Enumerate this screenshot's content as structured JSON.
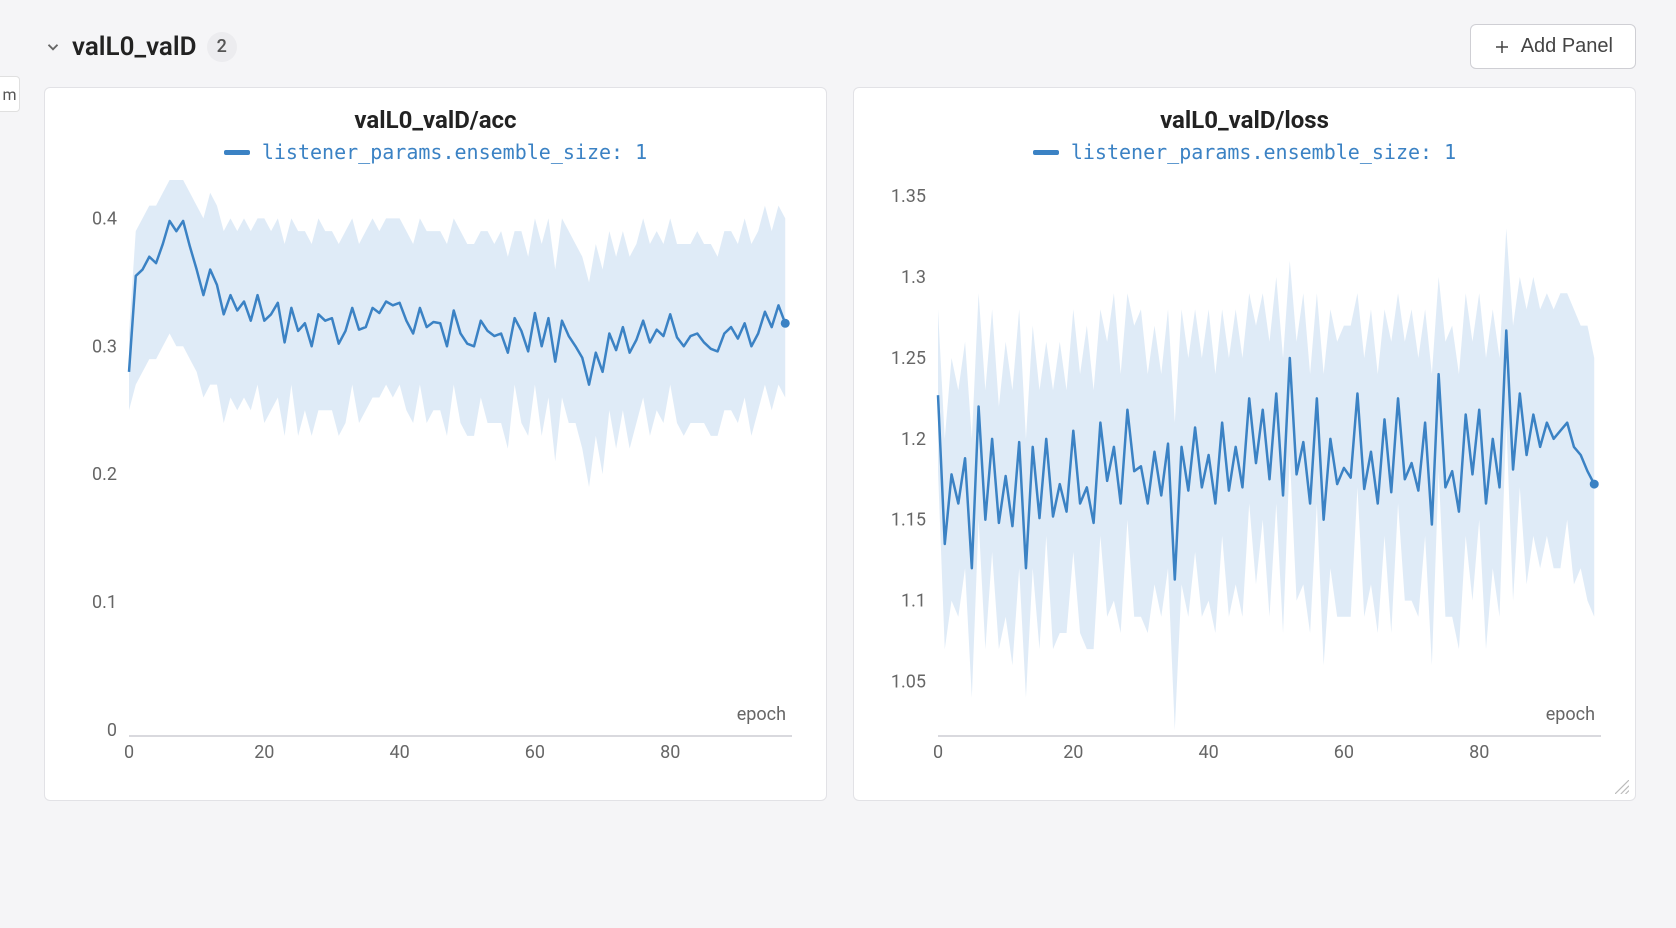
{
  "left_tab_letter": "m",
  "section": {
    "title": "valL0_valD",
    "count": "2"
  },
  "buttons": {
    "add_panel": "Add Panel"
  },
  "legend_label": "listener_params.ensemble_size: 1",
  "colors": {
    "series": "#3b82c4",
    "band": "#c9ddf1"
  },
  "chart_data": [
    {
      "type": "line",
      "title": "valL0_valD/acc",
      "xlabel": "epoch",
      "ylabel": "",
      "xlim": [
        0,
        98
      ],
      "ylim": [
        0,
        0.43
      ],
      "yticks": [
        0,
        0.1,
        0.2,
        0.3,
        0.4
      ],
      "xticks": [
        0,
        20,
        40,
        60,
        80
      ],
      "series": [
        {
          "name": "listener_params.ensemble_size: 1",
          "x": [
            0,
            1,
            2,
            3,
            4,
            5,
            6,
            7,
            8,
            9,
            10,
            11,
            12,
            13,
            14,
            15,
            16,
            17,
            18,
            19,
            20,
            21,
            22,
            23,
            24,
            25,
            26,
            27,
            28,
            29,
            30,
            31,
            32,
            33,
            34,
            35,
            36,
            37,
            38,
            39,
            40,
            41,
            42,
            43,
            44,
            45,
            46,
            47,
            48,
            49,
            50,
            51,
            52,
            53,
            54,
            55,
            56,
            57,
            58,
            59,
            60,
            61,
            62,
            63,
            64,
            65,
            66,
            67,
            68,
            69,
            70,
            71,
            72,
            73,
            74,
            75,
            76,
            77,
            78,
            79,
            80,
            81,
            82,
            83,
            84,
            85,
            86,
            87,
            88,
            89,
            90,
            91,
            92,
            93,
            94,
            95,
            96,
            97
          ],
          "y": [
            0.28,
            0.355,
            0.36,
            0.37,
            0.365,
            0.38,
            0.398,
            0.39,
            0.398,
            0.378,
            0.36,
            0.34,
            0.36,
            0.348,
            0.325,
            0.34,
            0.328,
            0.335,
            0.32,
            0.34,
            0.32,
            0.325,
            0.334,
            0.303,
            0.33,
            0.312,
            0.318,
            0.3,
            0.325,
            0.32,
            0.322,
            0.302,
            0.312,
            0.33,
            0.313,
            0.315,
            0.33,
            0.326,
            0.335,
            0.332,
            0.334,
            0.32,
            0.31,
            0.33,
            0.315,
            0.319,
            0.318,
            0.3,
            0.328,
            0.31,
            0.302,
            0.3,
            0.32,
            0.312,
            0.308,
            0.31,
            0.295,
            0.322,
            0.312,
            0.296,
            0.326,
            0.3,
            0.322,
            0.288,
            0.32,
            0.308,
            0.3,
            0.291,
            0.27,
            0.295,
            0.28,
            0.31,
            0.297,
            0.315,
            0.295,
            0.305,
            0.32,
            0.303,
            0.313,
            0.308,
            0.325,
            0.307,
            0.3,
            0.308,
            0.31,
            0.303,
            0.298,
            0.296,
            0.31,
            0.315,
            0.306,
            0.318,
            0.3,
            0.31,
            0.327,
            0.315,
            0.332,
            0.318
          ],
          "band_lo": [
            0.25,
            0.27,
            0.28,
            0.29,
            0.29,
            0.3,
            0.31,
            0.3,
            0.3,
            0.29,
            0.28,
            0.26,
            0.27,
            0.27,
            0.24,
            0.26,
            0.25,
            0.26,
            0.25,
            0.27,
            0.24,
            0.25,
            0.26,
            0.23,
            0.27,
            0.23,
            0.25,
            0.23,
            0.25,
            0.25,
            0.25,
            0.23,
            0.24,
            0.27,
            0.24,
            0.25,
            0.26,
            0.26,
            0.27,
            0.26,
            0.27,
            0.25,
            0.24,
            0.27,
            0.24,
            0.25,
            0.25,
            0.23,
            0.27,
            0.24,
            0.23,
            0.23,
            0.26,
            0.24,
            0.24,
            0.24,
            0.22,
            0.27,
            0.24,
            0.23,
            0.27,
            0.23,
            0.26,
            0.21,
            0.26,
            0.24,
            0.24,
            0.22,
            0.19,
            0.23,
            0.2,
            0.25,
            0.22,
            0.25,
            0.22,
            0.24,
            0.26,
            0.23,
            0.25,
            0.24,
            0.27,
            0.24,
            0.23,
            0.24,
            0.24,
            0.24,
            0.23,
            0.23,
            0.25,
            0.25,
            0.24,
            0.26,
            0.23,
            0.25,
            0.27,
            0.25,
            0.27,
            0.26
          ],
          "band_hi": [
            0.31,
            0.39,
            0.4,
            0.41,
            0.41,
            0.42,
            0.43,
            0.43,
            0.43,
            0.42,
            0.41,
            0.4,
            0.42,
            0.41,
            0.39,
            0.4,
            0.39,
            0.4,
            0.39,
            0.4,
            0.4,
            0.39,
            0.4,
            0.38,
            0.4,
            0.39,
            0.39,
            0.38,
            0.4,
            0.39,
            0.39,
            0.38,
            0.39,
            0.4,
            0.38,
            0.39,
            0.4,
            0.39,
            0.4,
            0.4,
            0.4,
            0.39,
            0.38,
            0.4,
            0.39,
            0.39,
            0.39,
            0.38,
            0.4,
            0.39,
            0.38,
            0.38,
            0.39,
            0.39,
            0.38,
            0.39,
            0.37,
            0.39,
            0.39,
            0.37,
            0.4,
            0.38,
            0.4,
            0.36,
            0.4,
            0.39,
            0.38,
            0.37,
            0.35,
            0.38,
            0.36,
            0.39,
            0.37,
            0.39,
            0.37,
            0.38,
            0.4,
            0.38,
            0.39,
            0.38,
            0.4,
            0.38,
            0.38,
            0.38,
            0.39,
            0.38,
            0.38,
            0.37,
            0.39,
            0.39,
            0.38,
            0.4,
            0.38,
            0.39,
            0.41,
            0.39,
            0.41,
            0.4
          ]
        }
      ]
    },
    {
      "type": "line",
      "title": "valL0_valD/loss",
      "xlabel": "epoch",
      "ylabel": "",
      "xlim": [
        0,
        98
      ],
      "ylim": [
        1.02,
        1.36
      ],
      "yticks": [
        1.05,
        1.1,
        1.15,
        1.2,
        1.25,
        1.3,
        1.35
      ],
      "xticks": [
        0,
        20,
        40,
        60,
        80
      ],
      "series": [
        {
          "name": "listener_params.ensemble_size: 1",
          "x": [
            0,
            1,
            2,
            3,
            4,
            5,
            6,
            7,
            8,
            9,
            10,
            11,
            12,
            13,
            14,
            15,
            16,
            17,
            18,
            19,
            20,
            21,
            22,
            23,
            24,
            25,
            26,
            27,
            28,
            29,
            30,
            31,
            32,
            33,
            34,
            35,
            36,
            37,
            38,
            39,
            40,
            41,
            42,
            43,
            44,
            45,
            46,
            47,
            48,
            49,
            50,
            51,
            52,
            53,
            54,
            55,
            56,
            57,
            58,
            59,
            60,
            61,
            62,
            63,
            64,
            65,
            66,
            67,
            68,
            69,
            70,
            71,
            72,
            73,
            74,
            75,
            76,
            77,
            78,
            79,
            80,
            81,
            82,
            83,
            84,
            85,
            86,
            87,
            88,
            89,
            90,
            91,
            92,
            93,
            94,
            95,
            96,
            97
          ],
          "y": [
            1.227,
            1.135,
            1.178,
            1.16,
            1.188,
            1.12,
            1.22,
            1.15,
            1.2,
            1.148,
            1.177,
            1.146,
            1.198,
            1.12,
            1.195,
            1.151,
            1.2,
            1.152,
            1.172,
            1.155,
            1.205,
            1.16,
            1.17,
            1.148,
            1.21,
            1.174,
            1.195,
            1.16,
            1.218,
            1.18,
            1.183,
            1.16,
            1.192,
            1.165,
            1.197,
            1.113,
            1.195,
            1.168,
            1.207,
            1.17,
            1.19,
            1.16,
            1.21,
            1.168,
            1.195,
            1.17,
            1.225,
            1.185,
            1.218,
            1.175,
            1.228,
            1.165,
            1.25,
            1.178,
            1.198,
            1.16,
            1.225,
            1.15,
            1.2,
            1.172,
            1.182,
            1.176,
            1.228,
            1.169,
            1.192,
            1.16,
            1.212,
            1.167,
            1.225,
            1.175,
            1.185,
            1.168,
            1.21,
            1.147,
            1.24,
            1.17,
            1.18,
            1.155,
            1.215,
            1.178,
            1.218,
            1.16,
            1.2,
            1.17,
            1.267,
            1.181,
            1.228,
            1.19,
            1.215,
            1.195,
            1.21,
            1.2,
            1.205,
            1.21,
            1.195,
            1.19,
            1.18,
            1.172
          ],
          "band_lo": [
            1.18,
            1.07,
            1.1,
            1.09,
            1.12,
            1.04,
            1.15,
            1.07,
            1.13,
            1.07,
            1.09,
            1.06,
            1.12,
            1.04,
            1.12,
            1.07,
            1.14,
            1.07,
            1.08,
            1.08,
            1.13,
            1.08,
            1.07,
            1.07,
            1.14,
            1.09,
            1.1,
            1.08,
            1.15,
            1.09,
            1.09,
            1.08,
            1.11,
            1.09,
            1.12,
            1.02,
            1.11,
            1.09,
            1.13,
            1.09,
            1.1,
            1.08,
            1.14,
            1.09,
            1.11,
            1.09,
            1.16,
            1.11,
            1.15,
            1.09,
            1.16,
            1.08,
            1.19,
            1.1,
            1.11,
            1.08,
            1.16,
            1.06,
            1.12,
            1.09,
            1.09,
            1.09,
            1.17,
            1.09,
            1.11,
            1.08,
            1.14,
            1.08,
            1.16,
            1.1,
            1.1,
            1.09,
            1.14,
            1.06,
            1.18,
            1.09,
            1.09,
            1.07,
            1.14,
            1.1,
            1.15,
            1.07,
            1.12,
            1.09,
            1.21,
            1.1,
            1.17,
            1.11,
            1.14,
            1.12,
            1.14,
            1.12,
            1.12,
            1.15,
            1.11,
            1.12,
            1.1,
            1.09
          ],
          "band_hi": [
            1.28,
            1.2,
            1.25,
            1.23,
            1.26,
            1.2,
            1.29,
            1.23,
            1.28,
            1.22,
            1.26,
            1.23,
            1.28,
            1.2,
            1.27,
            1.23,
            1.26,
            1.23,
            1.26,
            1.23,
            1.28,
            1.24,
            1.27,
            1.23,
            1.28,
            1.26,
            1.29,
            1.24,
            1.29,
            1.27,
            1.28,
            1.24,
            1.27,
            1.24,
            1.28,
            1.21,
            1.28,
            1.25,
            1.28,
            1.25,
            1.28,
            1.24,
            1.28,
            1.25,
            1.28,
            1.25,
            1.29,
            1.27,
            1.29,
            1.26,
            1.3,
            1.25,
            1.31,
            1.26,
            1.29,
            1.24,
            1.29,
            1.24,
            1.28,
            1.26,
            1.27,
            1.27,
            1.29,
            1.25,
            1.28,
            1.24,
            1.28,
            1.26,
            1.29,
            1.26,
            1.28,
            1.25,
            1.28,
            1.24,
            1.3,
            1.26,
            1.27,
            1.24,
            1.29,
            1.26,
            1.29,
            1.25,
            1.28,
            1.25,
            1.33,
            1.27,
            1.3,
            1.28,
            1.3,
            1.28,
            1.29,
            1.28,
            1.29,
            1.29,
            1.28,
            1.27,
            1.27,
            1.25
          ]
        }
      ]
    }
  ]
}
